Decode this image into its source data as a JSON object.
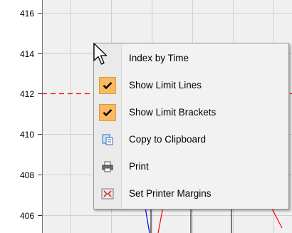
{
  "chart": {
    "y_ticks": [
      "416",
      "414",
      "412",
      "410",
      "408",
      "406"
    ],
    "limit_line_value": 412,
    "limit_line_color": "#ff0000",
    "series_colors": [
      "#0000ff",
      "#ff0000"
    ]
  },
  "context_menu": {
    "items": [
      {
        "label": "Index by Time",
        "icon": "none",
        "checked": false
      },
      {
        "label": "Show Limit Lines",
        "icon": "check-icon",
        "checked": true
      },
      {
        "label": "Show Limit Brackets",
        "icon": "check-icon",
        "checked": true
      },
      {
        "label": "Copy to Clipboard",
        "icon": "clipboard-icon",
        "checked": false
      },
      {
        "label": "Print",
        "icon": "printer-icon",
        "checked": false
      },
      {
        "label": "Set Printer Margins",
        "icon": "margins-icon",
        "checked": false
      }
    ]
  }
}
